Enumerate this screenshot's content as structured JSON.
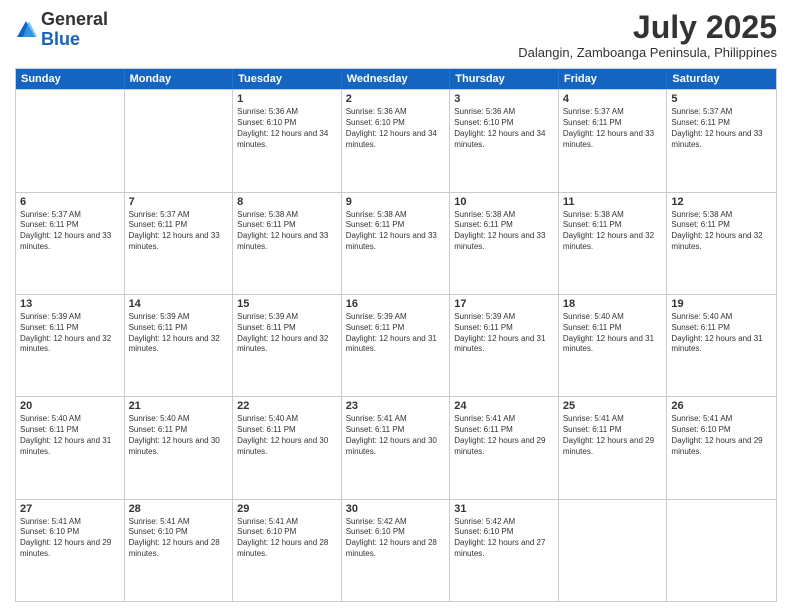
{
  "logo": {
    "general": "General",
    "blue": "Blue"
  },
  "header": {
    "month": "July 2025",
    "location": "Dalangin, Zamboanga Peninsula, Philippines"
  },
  "weekdays": [
    "Sunday",
    "Monday",
    "Tuesday",
    "Wednesday",
    "Thursday",
    "Friday",
    "Saturday"
  ],
  "weeks": [
    [
      {
        "day": "",
        "sunrise": "",
        "sunset": "",
        "daylight": ""
      },
      {
        "day": "",
        "sunrise": "",
        "sunset": "",
        "daylight": ""
      },
      {
        "day": "1",
        "sunrise": "Sunrise: 5:36 AM",
        "sunset": "Sunset: 6:10 PM",
        "daylight": "Daylight: 12 hours and 34 minutes."
      },
      {
        "day": "2",
        "sunrise": "Sunrise: 5:36 AM",
        "sunset": "Sunset: 6:10 PM",
        "daylight": "Daylight: 12 hours and 34 minutes."
      },
      {
        "day": "3",
        "sunrise": "Sunrise: 5:36 AM",
        "sunset": "Sunset: 6:10 PM",
        "daylight": "Daylight: 12 hours and 34 minutes."
      },
      {
        "day": "4",
        "sunrise": "Sunrise: 5:37 AM",
        "sunset": "Sunset: 6:11 PM",
        "daylight": "Daylight: 12 hours and 33 minutes."
      },
      {
        "day": "5",
        "sunrise": "Sunrise: 5:37 AM",
        "sunset": "Sunset: 6:11 PM",
        "daylight": "Daylight: 12 hours and 33 minutes."
      }
    ],
    [
      {
        "day": "6",
        "sunrise": "Sunrise: 5:37 AM",
        "sunset": "Sunset: 6:11 PM",
        "daylight": "Daylight: 12 hours and 33 minutes."
      },
      {
        "day": "7",
        "sunrise": "Sunrise: 5:37 AM",
        "sunset": "Sunset: 6:11 PM",
        "daylight": "Daylight: 12 hours and 33 minutes."
      },
      {
        "day": "8",
        "sunrise": "Sunrise: 5:38 AM",
        "sunset": "Sunset: 6:11 PM",
        "daylight": "Daylight: 12 hours and 33 minutes."
      },
      {
        "day": "9",
        "sunrise": "Sunrise: 5:38 AM",
        "sunset": "Sunset: 6:11 PM",
        "daylight": "Daylight: 12 hours and 33 minutes."
      },
      {
        "day": "10",
        "sunrise": "Sunrise: 5:38 AM",
        "sunset": "Sunset: 6:11 PM",
        "daylight": "Daylight: 12 hours and 33 minutes."
      },
      {
        "day": "11",
        "sunrise": "Sunrise: 5:38 AM",
        "sunset": "Sunset: 6:11 PM",
        "daylight": "Daylight: 12 hours and 32 minutes."
      },
      {
        "day": "12",
        "sunrise": "Sunrise: 5:38 AM",
        "sunset": "Sunset: 6:11 PM",
        "daylight": "Daylight: 12 hours and 32 minutes."
      }
    ],
    [
      {
        "day": "13",
        "sunrise": "Sunrise: 5:39 AM",
        "sunset": "Sunset: 6:11 PM",
        "daylight": "Daylight: 12 hours and 32 minutes."
      },
      {
        "day": "14",
        "sunrise": "Sunrise: 5:39 AM",
        "sunset": "Sunset: 6:11 PM",
        "daylight": "Daylight: 12 hours and 32 minutes."
      },
      {
        "day": "15",
        "sunrise": "Sunrise: 5:39 AM",
        "sunset": "Sunset: 6:11 PM",
        "daylight": "Daylight: 12 hours and 32 minutes."
      },
      {
        "day": "16",
        "sunrise": "Sunrise: 5:39 AM",
        "sunset": "Sunset: 6:11 PM",
        "daylight": "Daylight: 12 hours and 31 minutes."
      },
      {
        "day": "17",
        "sunrise": "Sunrise: 5:39 AM",
        "sunset": "Sunset: 6:11 PM",
        "daylight": "Daylight: 12 hours and 31 minutes."
      },
      {
        "day": "18",
        "sunrise": "Sunrise: 5:40 AM",
        "sunset": "Sunset: 6:11 PM",
        "daylight": "Daylight: 12 hours and 31 minutes."
      },
      {
        "day": "19",
        "sunrise": "Sunrise: 5:40 AM",
        "sunset": "Sunset: 6:11 PM",
        "daylight": "Daylight: 12 hours and 31 minutes."
      }
    ],
    [
      {
        "day": "20",
        "sunrise": "Sunrise: 5:40 AM",
        "sunset": "Sunset: 6:11 PM",
        "daylight": "Daylight: 12 hours and 31 minutes."
      },
      {
        "day": "21",
        "sunrise": "Sunrise: 5:40 AM",
        "sunset": "Sunset: 6:11 PM",
        "daylight": "Daylight: 12 hours and 30 minutes."
      },
      {
        "day": "22",
        "sunrise": "Sunrise: 5:40 AM",
        "sunset": "Sunset: 6:11 PM",
        "daylight": "Daylight: 12 hours and 30 minutes."
      },
      {
        "day": "23",
        "sunrise": "Sunrise: 5:41 AM",
        "sunset": "Sunset: 6:11 PM",
        "daylight": "Daylight: 12 hours and 30 minutes."
      },
      {
        "day": "24",
        "sunrise": "Sunrise: 5:41 AM",
        "sunset": "Sunset: 6:11 PM",
        "daylight": "Daylight: 12 hours and 29 minutes."
      },
      {
        "day": "25",
        "sunrise": "Sunrise: 5:41 AM",
        "sunset": "Sunset: 6:11 PM",
        "daylight": "Daylight: 12 hours and 29 minutes."
      },
      {
        "day": "26",
        "sunrise": "Sunrise: 5:41 AM",
        "sunset": "Sunset: 6:10 PM",
        "daylight": "Daylight: 12 hours and 29 minutes."
      }
    ],
    [
      {
        "day": "27",
        "sunrise": "Sunrise: 5:41 AM",
        "sunset": "Sunset: 6:10 PM",
        "daylight": "Daylight: 12 hours and 29 minutes."
      },
      {
        "day": "28",
        "sunrise": "Sunrise: 5:41 AM",
        "sunset": "Sunset: 6:10 PM",
        "daylight": "Daylight: 12 hours and 28 minutes."
      },
      {
        "day": "29",
        "sunrise": "Sunrise: 5:41 AM",
        "sunset": "Sunset: 6:10 PM",
        "daylight": "Daylight: 12 hours and 28 minutes."
      },
      {
        "day": "30",
        "sunrise": "Sunrise: 5:42 AM",
        "sunset": "Sunset: 6:10 PM",
        "daylight": "Daylight: 12 hours and 28 minutes."
      },
      {
        "day": "31",
        "sunrise": "Sunrise: 5:42 AM",
        "sunset": "Sunset: 6:10 PM",
        "daylight": "Daylight: 12 hours and 27 minutes."
      },
      {
        "day": "",
        "sunrise": "",
        "sunset": "",
        "daylight": ""
      },
      {
        "day": "",
        "sunrise": "",
        "sunset": "",
        "daylight": ""
      }
    ]
  ]
}
